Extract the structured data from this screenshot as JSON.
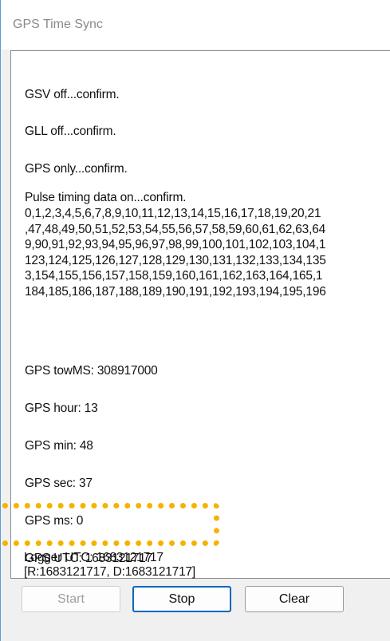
{
  "window": {
    "title": "GPS Time Sync"
  },
  "log": {
    "gsv": "GSV off...confirm.",
    "gll": "GLL off...confirm.",
    "gps_only": "GPS only...confirm.",
    "pulse_header": "Pulse timing data on...confirm.",
    "pulse_lines": [
      "0,1,2,3,4,5,6,7,8,9,10,11,12,13,14,15,16,17,18,19,20,21",
      ",47,48,49,50,51,52,53,54,55,56,57,58,59,60,61,62,63,64",
      "9,90,91,92,93,94,95,96,97,98,99,100,101,102,103,104,1",
      "123,124,125,126,127,128,129,130,131,132,133,134,135",
      "3,154,155,156,157,158,159,160,161,162,163,164,165,1",
      "184,185,186,187,188,189,190,191,192,193,194,195,196"
    ],
    "tow_ms": "GPS towMS: 308917000",
    "hour": "GPS hour: 13",
    "min": "GPS min: 48",
    "sec": "GPS sec: 37",
    "ms": "GPS ms: 0",
    "gps_utc": "GPS UTC: 1683121717",
    "logger_utc": "Logger UTC: 1683121717",
    "rd_line": "[R:1683121717,  D:1683121717]"
  },
  "buttons": {
    "start": "Start",
    "stop": "Stop",
    "clear": "Clear"
  },
  "colors": {
    "highlight": "#f5b301",
    "focus_border": "#0067c0"
  }
}
